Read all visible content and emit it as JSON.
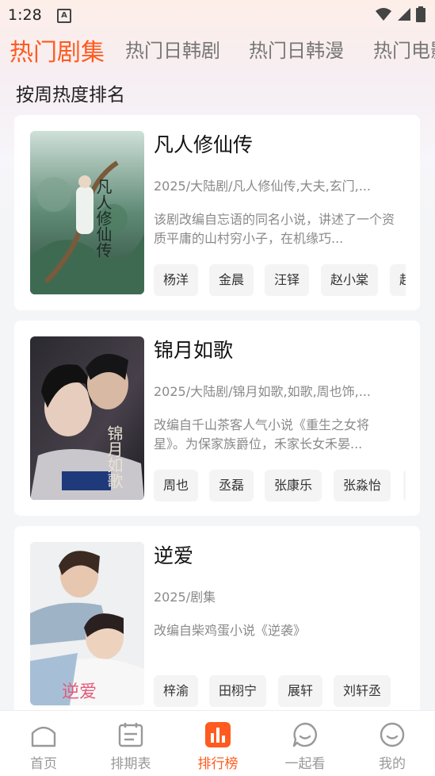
{
  "status": {
    "time": "1:28",
    "notification_badge": "A"
  },
  "tabs": [
    {
      "label": "热门剧集",
      "active": true
    },
    {
      "label": "热门日韩剧",
      "active": false
    },
    {
      "label": "热门日韩漫",
      "active": false
    },
    {
      "label": "热门电影",
      "active": false
    }
  ],
  "subheading": "按周热度排名",
  "cards": [
    {
      "title": "凡人修仙传",
      "meta": "2025/大陆剧/凡人修仙传,大夫,玄门,...",
      "desc": "该剧改编自忘语的同名小说，讲述了一个资质平庸的山村穷小子，在机缘巧...",
      "cast": [
        "杨洋",
        "金晨",
        "汪铎",
        "赵小棠",
        "赵"
      ]
    },
    {
      "title": "锦月如歌",
      "meta": "2025/大陆剧/锦月如歌,如歌,周也饰,...",
      "desc": "改编自千山茶客人气小说《重生之女将星》。为保家族爵位，禾家长女禾晏...",
      "cast": [
        "周也",
        "丞磊",
        "张康乐",
        "张淼怡",
        ""
      ]
    },
    {
      "title": "逆爱",
      "meta": "2025/剧集",
      "desc": "改编自柴鸡蛋小说《逆袭》",
      "cast": [
        "梓渝",
        "田栩宁",
        "展轩",
        "刘轩丞"
      ]
    }
  ],
  "poster_text": {
    "p1": "凡人修仙传",
    "p2": "锦月如歌",
    "p3": "逆爱"
  },
  "nav": [
    {
      "label": "首页",
      "icon": "home-icon"
    },
    {
      "label": "排期表",
      "icon": "calendar-icon"
    },
    {
      "label": "排行榜",
      "icon": "ranking-icon",
      "active": true
    },
    {
      "label": "一起看",
      "icon": "chat-bubble-icon"
    },
    {
      "label": "我的",
      "icon": "smiley-icon"
    }
  ],
  "colors": {
    "accent": "#ff5a1f",
    "inactive": "#999999"
  }
}
